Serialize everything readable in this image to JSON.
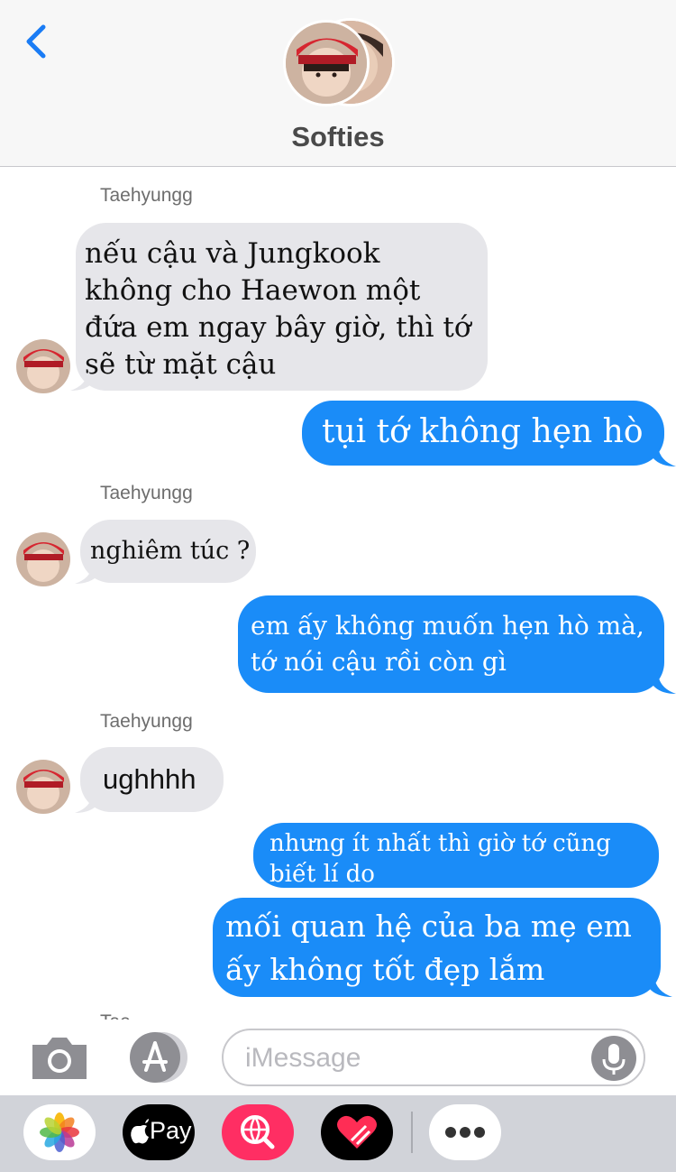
{
  "header": {
    "title": "Softies",
    "back_icon": "chevron-left-icon"
  },
  "messages": [
    {
      "type": "sender",
      "text": "Taehyungg"
    },
    {
      "type": "in",
      "text": "nếu cậu và Jungkook không cho Haewon một đứa em ngay bây giờ, thì tớ sẽ từ mặt cậu"
    },
    {
      "type": "out",
      "text": "tụi tớ không hẹn hò"
    },
    {
      "type": "sender",
      "text": "Taehyungg"
    },
    {
      "type": "in",
      "text": "nghiêm túc ?"
    },
    {
      "type": "out",
      "text": "em ấy không muốn hẹn hò mà, tớ nói cậu rồi còn gì"
    },
    {
      "type": "sender",
      "text": "Taehyungg"
    },
    {
      "type": "in",
      "text": "ughhhh"
    },
    {
      "type": "out",
      "text": "nhưng ít nhất thì giờ tớ cũng biết lí do"
    },
    {
      "type": "out",
      "text": "mối quan hệ của ba mẹ em ấy không tốt đẹp lắm"
    },
    {
      "type": "sender",
      "text": "Tae"
    }
  ],
  "composer": {
    "placeholder": "iMessage",
    "camera_icon": "camera-icon",
    "appstore_icon": "app-store-icon",
    "mic_icon": "microphone-icon"
  },
  "app_drawer": {
    "items": [
      {
        "name": "photos",
        "icon": "photos-icon"
      },
      {
        "name": "apple-pay",
        "label": "Pay",
        "icon": "apple-icon"
      },
      {
        "name": "search-images",
        "icon": "globe-search-icon"
      },
      {
        "name": "digital-touch",
        "icon": "heart-icon"
      },
      {
        "name": "more",
        "icon": "more-icon"
      }
    ]
  },
  "colors": {
    "outgoing": "#1a8cf8",
    "incoming": "#e6e6ea",
    "accent": "#1a7cf5"
  }
}
